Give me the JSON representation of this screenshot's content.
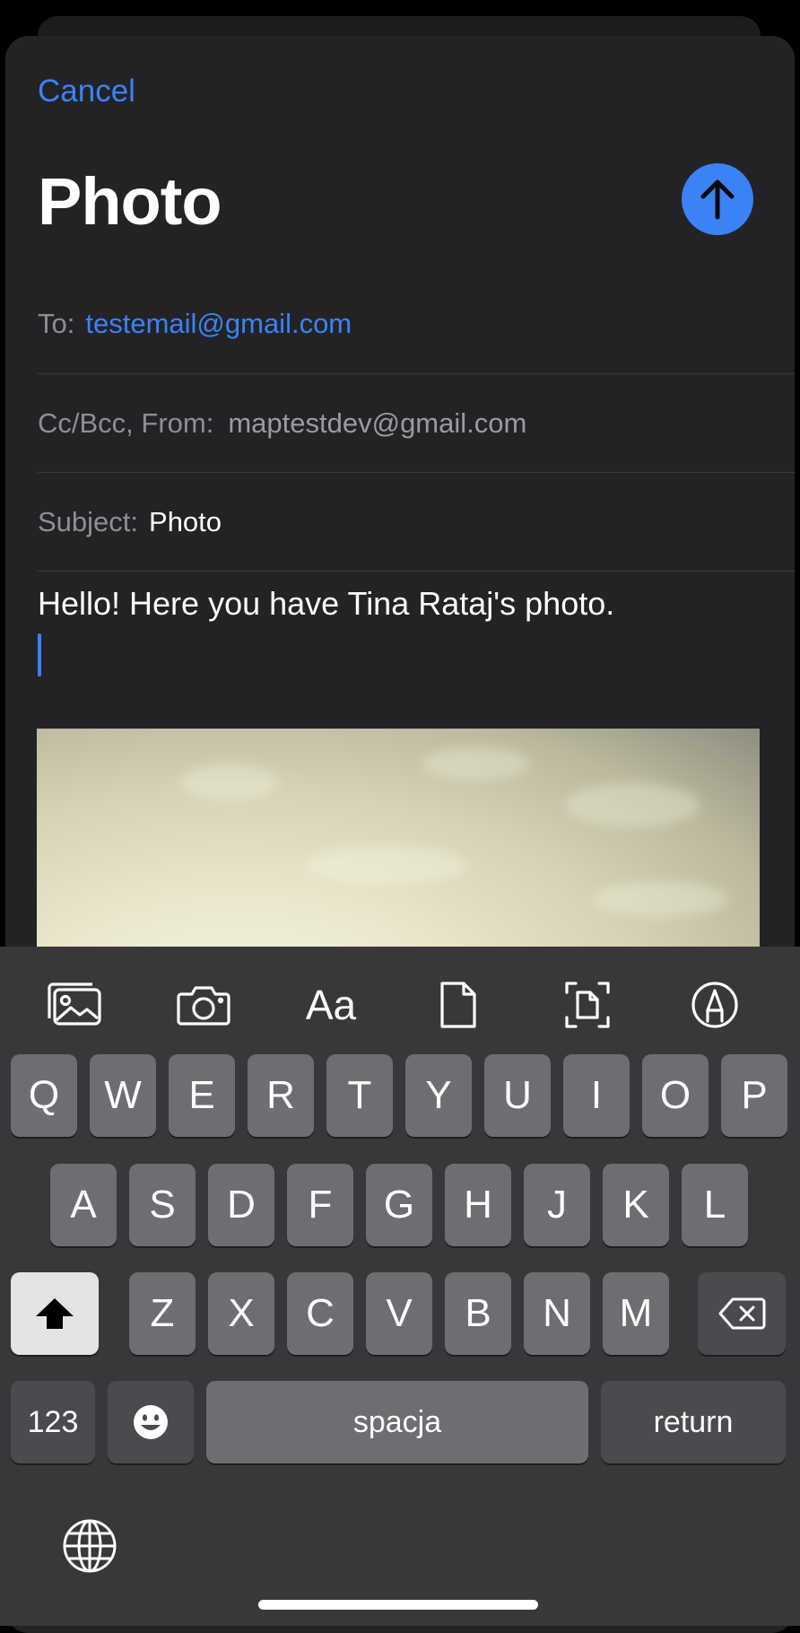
{
  "header": {
    "cancel_label": "Cancel",
    "title": "Photo"
  },
  "fields": {
    "to_label": "To:",
    "to_value": "testemail@gmail.com",
    "ccbcc_label": "Cc/Bcc, From:",
    "from_value": "maptestdev@gmail.com",
    "subject_label": "Subject:",
    "subject_value": "Photo"
  },
  "body": {
    "text": "Hello! Here you have Tina Rataj's photo."
  },
  "toolbar": {
    "icons": [
      "photo-library-icon",
      "camera-icon",
      "text-format-icon",
      "document-icon",
      "scan-document-icon",
      "markup-icon"
    ],
    "format_label": "Aa"
  },
  "keyboard": {
    "row1": [
      "Q",
      "W",
      "E",
      "R",
      "T",
      "Y",
      "U",
      "I",
      "O",
      "P"
    ],
    "row2": [
      "A",
      "S",
      "D",
      "F",
      "G",
      "H",
      "J",
      "K",
      "L"
    ],
    "row3": [
      "Z",
      "X",
      "C",
      "V",
      "B",
      "N",
      "M"
    ],
    "numbers_label": "123",
    "space_label": "spacja",
    "return_label": "return"
  },
  "colors": {
    "accent": "#3b82f6",
    "sheet": "#232326",
    "keyboard": "#38383b",
    "key": "#6e6e72"
  }
}
